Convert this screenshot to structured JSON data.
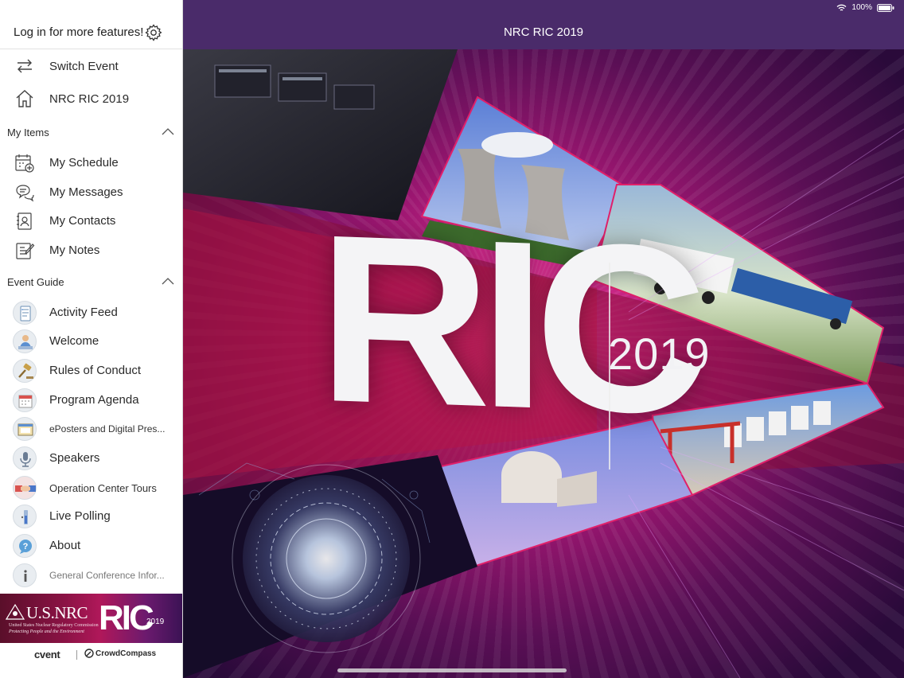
{
  "status_bar": {
    "battery": "100%"
  },
  "sidebar": {
    "login_text": "Log in for more features!",
    "nav": [
      {
        "label": "Switch Event",
        "icon": "switch-arrows-icon"
      },
      {
        "label": "NRC RIC 2019",
        "icon": "home-icon"
      }
    ],
    "sections": [
      {
        "title": "My Items",
        "items": [
          {
            "label": "My Schedule",
            "icon": "calendar-add-icon"
          },
          {
            "label": "My Messages",
            "icon": "chat-bubbles-icon"
          },
          {
            "label": "My Contacts",
            "icon": "contact-card-icon"
          },
          {
            "label": "My Notes",
            "icon": "notepad-icon"
          }
        ]
      },
      {
        "title": "Event Guide",
        "items": [
          {
            "label": "Activity Feed",
            "icon": "activity-feed-icon"
          },
          {
            "label": "Welcome",
            "icon": "welcome-person-icon"
          },
          {
            "label": "Rules of Conduct",
            "icon": "gavel-icon"
          },
          {
            "label": "Program Agenda",
            "icon": "agenda-calendar-icon"
          },
          {
            "label": "ePosters and Digital Pres...",
            "icon": "poster-board-icon"
          },
          {
            "label": "Speakers",
            "icon": "microphone-icon"
          },
          {
            "label": "Operation Center Tours",
            "icon": "handshake-icon"
          },
          {
            "label": "Live Polling",
            "icon": "polling-icon"
          },
          {
            "label": "About",
            "icon": "question-bubble-icon"
          },
          {
            "label": "General Conference Infor...",
            "icon": "info-icon"
          }
        ]
      }
    ],
    "banner": {
      "agency": "U.S.NRC",
      "agency_full": "United States Nuclear Regulatory Commission",
      "tagline": "Protecting People and the Environment",
      "logo_text": "RIC",
      "logo_year": "2019"
    },
    "footer": {
      "brand1": "cvent",
      "brand2": "CrowdCompass"
    }
  },
  "header": {
    "title": "NRC RIC 2019"
  },
  "hero": {
    "logo_text": "RIC",
    "year": "2019"
  },
  "colors": {
    "header_bg": "#4a2b6a",
    "hero_magenta": "#d0298a"
  }
}
